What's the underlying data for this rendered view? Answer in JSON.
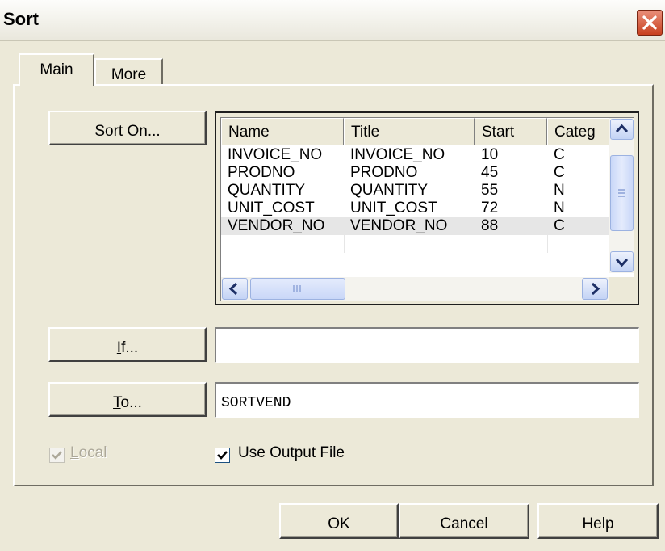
{
  "window": {
    "title": "Sort"
  },
  "colors": {
    "window_bg": "#ece9d8",
    "selected_row": "#e6e6e6",
    "close_button": "#c8401f"
  },
  "tabs": [
    {
      "label": "Main",
      "selected": true
    },
    {
      "label": "More",
      "selected": false
    }
  ],
  "main": {
    "sort_on": {
      "pre": "Sort ",
      "mnemonic": "O",
      "post": "n..."
    },
    "if_button": {
      "pre": "",
      "mnemonic": "I",
      "post": "f..."
    },
    "to_button": {
      "pre": "",
      "mnemonic": "T",
      "post": "o..."
    },
    "if_value": "",
    "to_value": "SORTVEND",
    "table": {
      "columns": [
        "Name",
        "Title",
        "Start",
        "Categ"
      ],
      "rows": [
        [
          "INVOICE_NO",
          "INVOICE_NO",
          "10",
          "C"
        ],
        [
          "PRODNO",
          "PRODNO",
          "45",
          "C"
        ],
        [
          "QUANTITY",
          "QUANTITY",
          "55",
          "N"
        ],
        [
          "UNIT_COST",
          "UNIT_COST",
          "72",
          "N"
        ],
        [
          "VENDOR_NO",
          "VENDOR_NO",
          "88",
          "C"
        ]
      ],
      "selected_row": 4
    },
    "local": {
      "pre": "",
      "mnemonic": "L",
      "post": "ocal",
      "checked": true,
      "disabled": true
    },
    "use_output_file": {
      "label": "Use Output File",
      "checked": true
    }
  },
  "footer": {
    "ok": "OK",
    "cancel": "Cancel",
    "help": "Help"
  },
  "icons": {
    "close": "close-icon",
    "up": "scroll-up-arrow-icon",
    "down": "scroll-down-arrow-icon",
    "left": "scroll-left-arrow-icon",
    "right": "scroll-right-arrow-icon",
    "check": "checkmark-icon"
  }
}
